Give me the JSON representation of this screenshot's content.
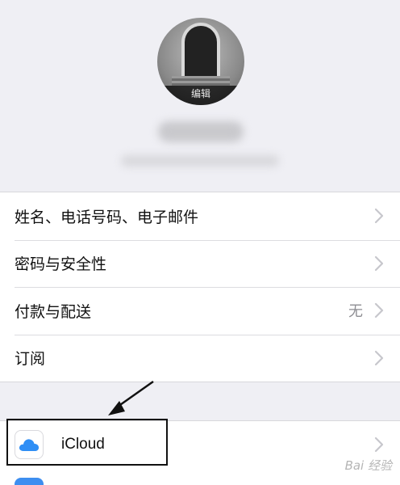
{
  "profile": {
    "edit_label": "编辑"
  },
  "group1": {
    "rows": [
      {
        "label": "姓名、电话号码、电子邮件",
        "value": ""
      },
      {
        "label": "密码与安全性",
        "value": ""
      },
      {
        "label": "付款与配送",
        "value": "无"
      },
      {
        "label": "订阅",
        "value": ""
      }
    ]
  },
  "group2": {
    "icloud_label": "iCloud"
  },
  "watermark": "Bai 经验",
  "colors": {
    "background": "#efeff4",
    "row_bg": "#ffffff",
    "chevron": "#c7c7cc",
    "icloud_blue": "#2f8ef5"
  },
  "icons": [
    "chevron-right-icon",
    "icloud-icon",
    "avatar-photo"
  ]
}
